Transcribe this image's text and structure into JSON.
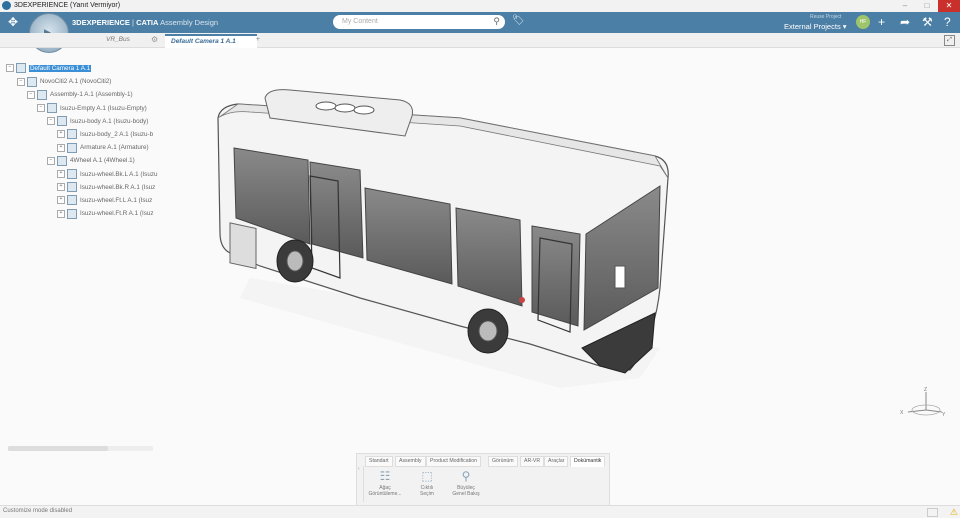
{
  "window": {
    "title": "3DEXPERIENCE (Yanıt Vermiyor)",
    "controls": {
      "minimize": "–",
      "maximize": "□",
      "close": "✕"
    }
  },
  "topbar": {
    "brand_prefix": "3DEXPERIENCE",
    "brand_sep": " | ",
    "brand_app": "CATIA",
    "brand_module": " Assembly Design",
    "search_placeholder": "My Content",
    "project_label": "Reuse Project",
    "project_value": "External Projects",
    "avatar_initials": "HF",
    "icons": [
      "compass-icon",
      "search-icon",
      "tag-icon",
      "add-icon",
      "share-icon",
      "tools-icon",
      "help-icon"
    ]
  },
  "tabs": [
    {
      "label": "VR_Bus",
      "active": false
    },
    {
      "label": "Default Camera 1 A.1",
      "active": true
    },
    {
      "label": "+",
      "active": false
    }
  ],
  "tree": [
    {
      "label": "Default Camera 1 A.1",
      "level": 0,
      "selected": true,
      "expander": "−"
    },
    {
      "label": "NovoCiti2 A.1 (NovoCiti2)",
      "level": 1,
      "expander": "−"
    },
    {
      "label": "Assembly-1 A.1 (Assembly-1)",
      "level": 2,
      "expander": "−"
    },
    {
      "label": "Isuzu-Empty A.1 (Isuzu-Empty)",
      "level": 3,
      "expander": "−"
    },
    {
      "label": "Isuzu-body A.1 (Isuzu-body)",
      "level": 4,
      "expander": "−"
    },
    {
      "label": "Isuzu-body_2 A.1 (Isuzu-b",
      "level": 5,
      "expander": "+"
    },
    {
      "label": "Armature A.1 (Armature)",
      "level": 5,
      "expander": "+"
    },
    {
      "label": "4Wheel A.1 (4Wheel.1)",
      "level": 4,
      "expander": "−"
    },
    {
      "label": "Isuzu-wheel.Bk.L A.1 (Isuzu",
      "level": 5,
      "expander": "+"
    },
    {
      "label": "Isuzu-wheel.Bk.R A.1 (Isuz",
      "level": 5,
      "expander": "+"
    },
    {
      "label": "Isuzu-wheel.Ft.L A.1 (Isuz",
      "level": 5,
      "expander": "+"
    },
    {
      "label": "Isuzu-wheel.Ft.R A.1 (Isuz",
      "level": 5,
      "expander": "+"
    }
  ],
  "axes": {
    "z": "Z",
    "x": "X",
    "y": "Y"
  },
  "action_bar": {
    "tabs": [
      {
        "label": "Standart",
        "active": false
      },
      {
        "label": "Assembly",
        "active": false
      },
      {
        "label": "Product Modification",
        "active": false
      },
      {
        "label": "Görünüm",
        "active": false
      },
      {
        "label": "AR-VR",
        "active": false
      },
      {
        "label": "Araçlar",
        "active": false
      },
      {
        "label": "Dokümantik",
        "active": true
      }
    ],
    "buttons": [
      {
        "line1": "Ağaç",
        "line2": "Görüntüleme...",
        "icon": "tree-view-icon"
      },
      {
        "line1": "Cıktılı",
        "line2": "Seçim",
        "icon": "selection-icon"
      },
      {
        "line1": "Büyüleç",
        "line2": "Genel Bakış",
        "icon": "magnifier-icon"
      }
    ]
  },
  "status": {
    "text": "Customize mode disabled"
  },
  "colors": {
    "accent": "#4b7fa6",
    "selection": "#3a8fd6",
    "close": "#c9302c"
  }
}
